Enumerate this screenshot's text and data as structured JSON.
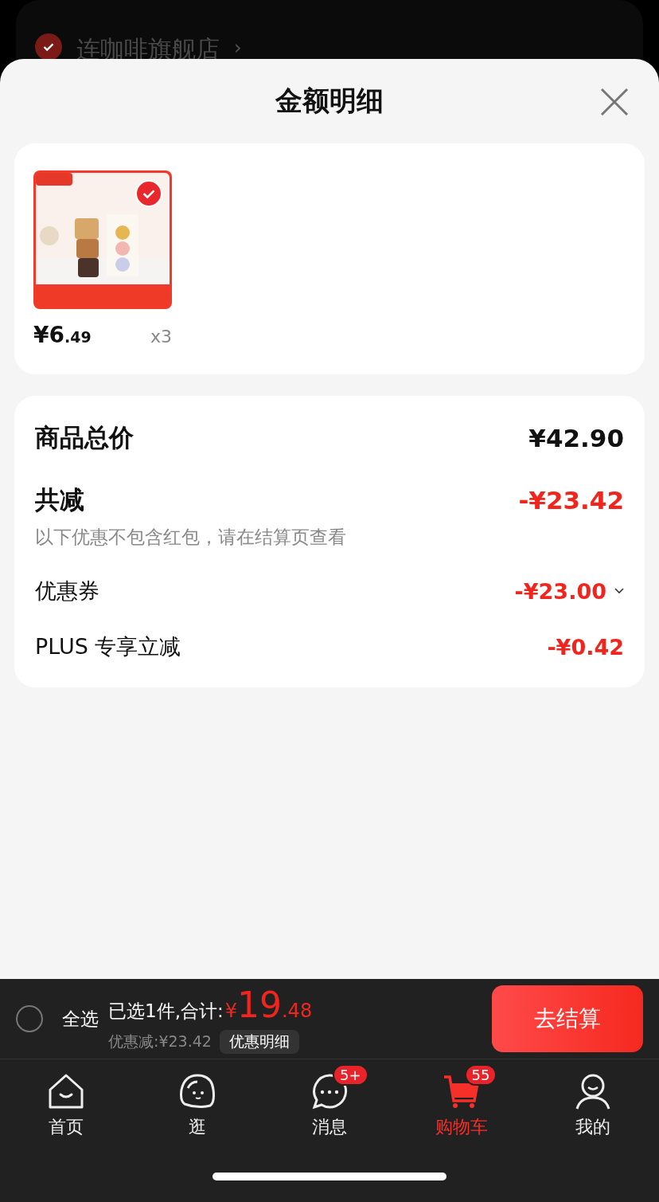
{
  "background_store": {
    "name": "连咖啡旗舰店",
    "checked": true,
    "arrow": "›"
  },
  "sheet": {
    "title": "金额明细"
  },
  "items": [
    {
      "kind": "picture",
      "selected": true,
      "price_main": "¥6",
      "price_decimal": ".49",
      "quantity": "x3"
    }
  ],
  "summary": {
    "total_label": "商品总价",
    "total_value": "¥42.90",
    "discount_label": "共减",
    "discount_value": "-¥23.42",
    "note": "以下优惠不包含红包，请在结算页查看",
    "lines": [
      {
        "label": "优惠券",
        "value": "-¥23.00",
        "expandable": true
      },
      {
        "label": "PLUS 专享立减",
        "value": "-¥0.42",
        "expandable": false
      }
    ]
  },
  "checkout_bar": {
    "select_all": {
      "label": "全选",
      "checked": false
    },
    "selected_text": "已选1件,合计:",
    "currency": "¥",
    "amount_main": "19",
    "amount_decimal": ".48",
    "saving": "优惠减:¥23.42",
    "details_button": "优惠明细",
    "checkout_button": "去结算"
  },
  "tab_bar": [
    {
      "kind": "home",
      "label": "首页",
      "selected": false
    },
    {
      "kind": "stroll",
      "label": "逛",
      "selected": false
    },
    {
      "kind": "message",
      "label": "消息",
      "selected": false,
      "badge": "5+"
    },
    {
      "kind": "cart",
      "label": "购物车",
      "selected": true,
      "badge": "55"
    },
    {
      "kind": "me",
      "label": "我的",
      "selected": false
    }
  ]
}
